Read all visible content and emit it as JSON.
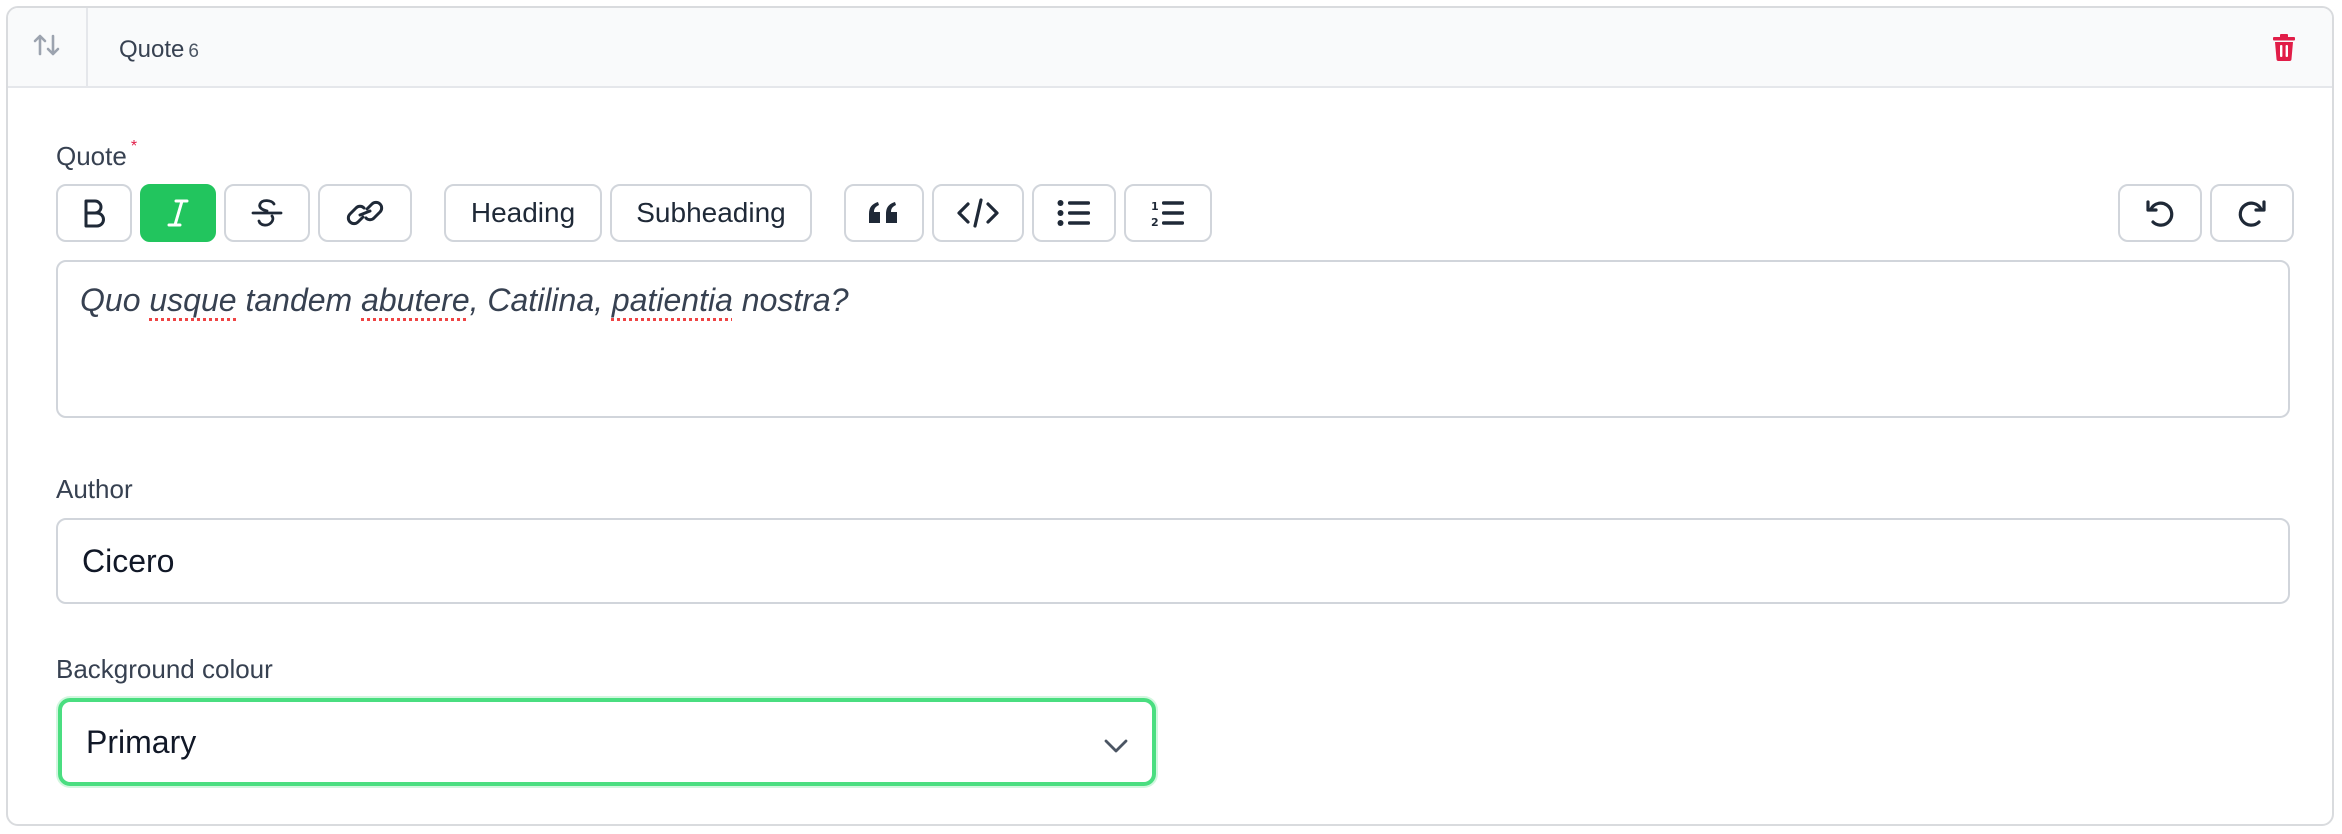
{
  "block": {
    "title": "Quote",
    "number": "6",
    "drag_icon": "arrows-up-down-icon",
    "delete_icon": "trash-icon"
  },
  "quote_field": {
    "label": "Quote",
    "required_mark": "*",
    "toolbar": {
      "bold_icon": "bold-icon",
      "italic_icon": "italic-icon",
      "italic_active": true,
      "strike_icon": "strikethrough-icon",
      "link_icon": "link-icon",
      "heading_label": "Heading",
      "subheading_label": "Subheading",
      "blockquote_icon": "quote-icon",
      "code_icon": "code-icon",
      "bullet_list_icon": "bullet-list-icon",
      "ordered_list_icon": "ordered-list-icon",
      "undo_icon": "undo-icon",
      "redo_icon": "redo-icon"
    },
    "value_parts": [
      "Quo ",
      "usque",
      " tandem ",
      "abutere",
      ", Catilina, ",
      "patientia",
      " nostra?"
    ]
  },
  "author_field": {
    "label": "Author",
    "value": "Cicero"
  },
  "background_field": {
    "label": "Background colour",
    "selected": "Primary",
    "chevron_icon": "chevron-down-icon"
  },
  "colors": {
    "accent": "#22c55e",
    "focus_ring": "#4ade80",
    "danger": "#e11d48"
  }
}
